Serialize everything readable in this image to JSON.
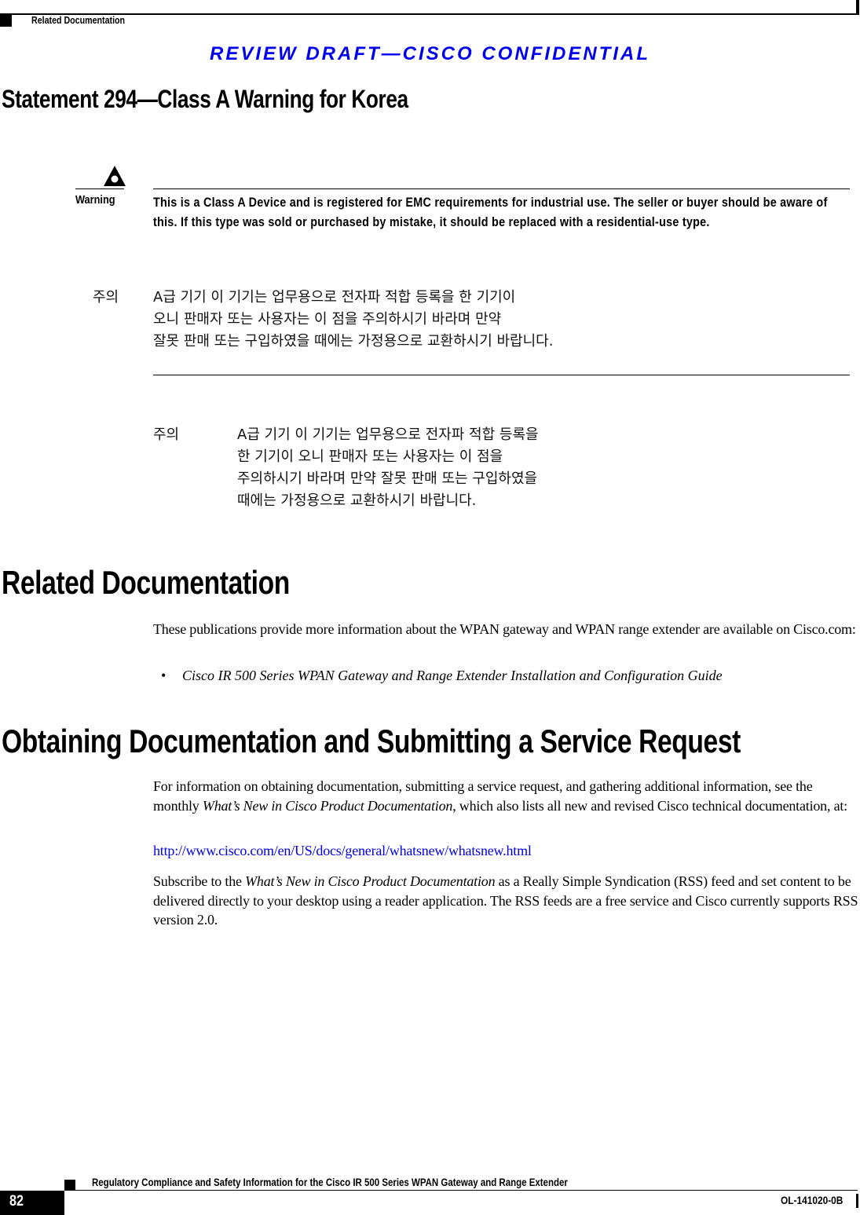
{
  "header": {
    "section": "Related Documentation",
    "draft_banner": "REVIEW DRAFT—CISCO CONFIDENTIAL"
  },
  "statement": {
    "title": "Statement 294—Class A Warning for Korea",
    "warning": {
      "icon": "warning-triangle-icon",
      "label": "Warning",
      "text": "This is a Class A Device and is registered for EMC requirements for industrial use. The seller or buyer should be aware of this. If this type was sold or purchased by mistake, it should be replaced with a residential-use type."
    },
    "korean_block_1": {
      "label": "주의",
      "lines": [
        "A급 기기  이  기기는  업무용으로  전자파  적합  등록을  한  기기이",
        "오니  판매자  또는  사용자는  이  점을  주의하시기  바라며  만약",
        "잘못  판매  또는  구입하였을  때에는  가정용으로 교환하시기 바랍니다."
      ]
    },
    "korean_block_2": {
      "label": "주의",
      "lines": [
        "A급 기기  이  기기는  업무용으로  전자파  적합  등록을",
        "한  기기이  오니  판매자  또는  사용자는  이  점을",
        "주의하시기  바라며  만약   잘못  판매  또는  구입하였을",
        "때에는  가정용으로  교환하시기  바랍니다."
      ]
    }
  },
  "related_documentation": {
    "title": "Related Documentation",
    "intro": "These publications provide more information about the WPAN gateway and WPAN range extender are available on Cisco.com:",
    "bullet_symbol": "•",
    "items": [
      "Cisco IR 500 Series WPAN Gateway and Range Extender Installation and Configuration Guide"
    ]
  },
  "obtaining_documentation": {
    "title": "Obtaining Documentation and Submitting a Service Request",
    "para1_part1": "For information on obtaining documentation, submitting a service request, and gathering additional information, see the monthly ",
    "para1_italic": "What’s New in Cisco Product Documentation",
    "para1_part2": ", which also lists all new and revised Cisco technical documentation, at:",
    "link": "http://www.cisco.com/en/US/docs/general/whatsnew/whatsnew.html",
    "para2_part1": "Subscribe to the ",
    "para2_italic": "What’s New in Cisco Product Documentation",
    "para2_part2": " as a Really Simple Syndication (RSS) feed and set content to be delivered directly to your desktop using a reader application. The RSS feeds are a free service and Cisco currently supports RSS version 2.0."
  },
  "footer": {
    "title": "Regulatory Compliance and Safety Information for the Cisco IR 500 Series WPAN Gateway and Range Extender",
    "page_number": "82",
    "doc_id": "OL-141020-0B"
  },
  "colors": {
    "draft_banner": "#0000ee",
    "link": "#0000ee",
    "text": "#000000"
  }
}
